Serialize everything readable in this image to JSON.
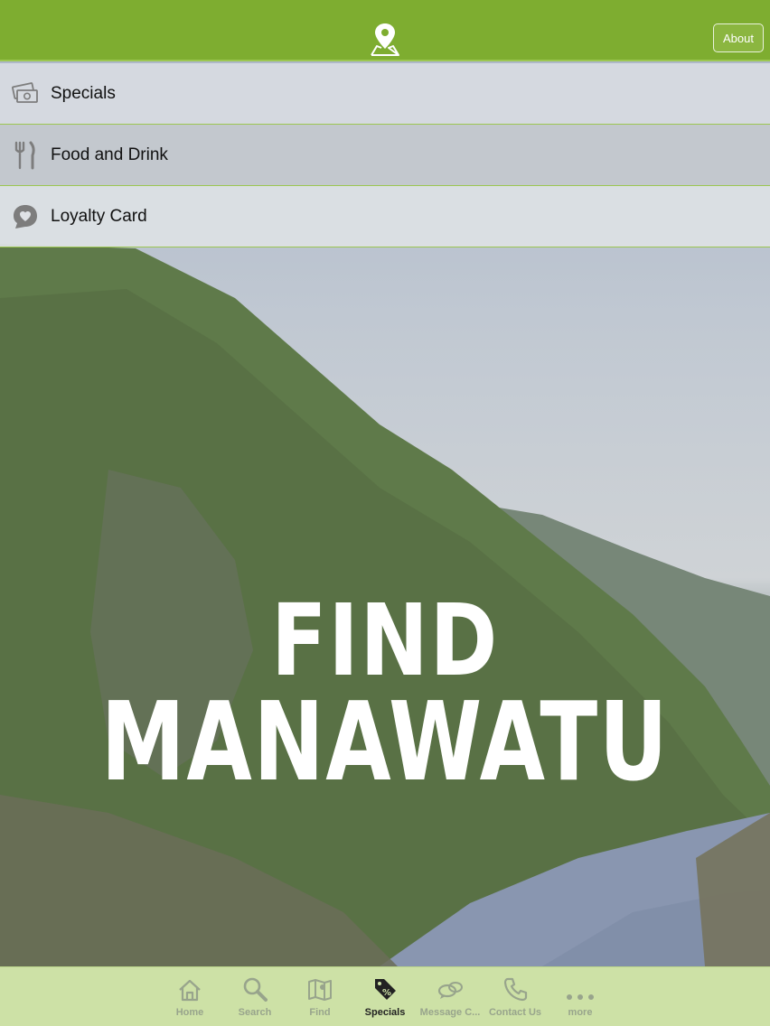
{
  "header": {
    "logo_icon": "map-pin-icon",
    "about_label": "About",
    "brand_color": "#7ead30"
  },
  "menu": {
    "items": [
      {
        "label": "Specials",
        "icon": "money-icon"
      },
      {
        "label": "Food and Drink",
        "icon": "fork-knife-icon"
      },
      {
        "label": "Loyalty Card",
        "icon": "heart-bubble-icon"
      }
    ]
  },
  "hero": {
    "line1": "FIND",
    "line2": "MANAWATU"
  },
  "tabbar": {
    "active": "Specials",
    "tabs": [
      {
        "label": "Home",
        "icon": "home-icon"
      },
      {
        "label": "Search",
        "icon": "search-icon"
      },
      {
        "label": "Find",
        "icon": "map-icon"
      },
      {
        "label": "Specials",
        "icon": "tag-icon"
      },
      {
        "label": "Message C...",
        "icon": "chat-icon"
      },
      {
        "label": "Contact Us",
        "icon": "phone-icon"
      },
      {
        "label": "more",
        "icon": "more-icon"
      }
    ]
  }
}
